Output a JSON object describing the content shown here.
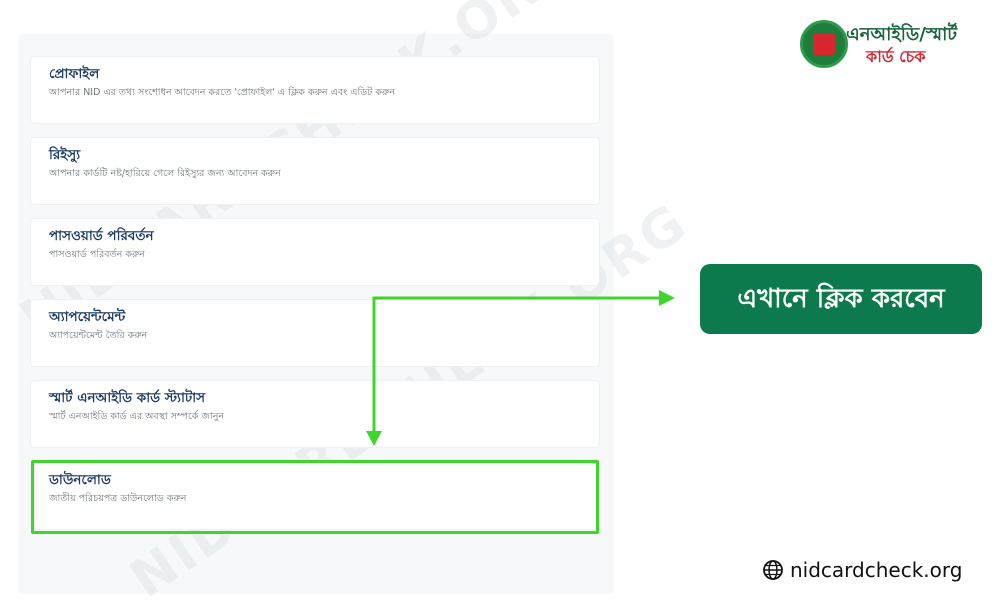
{
  "logo": {
    "line1": "এনআইডি/স্মার্ট",
    "line2": "কার্ড চেক",
    "icon": "nid-emblem-icon"
  },
  "menu": {
    "items": [
      {
        "title": "প্রোফাইল",
        "subtitle": "আপনার NID এর তথ্য সংশোধন আবেদন করতে 'প্রোফাইল' এ ক্লিক করুন এবং এডিট করুন"
      },
      {
        "title": "রিইস্যু",
        "subtitle": "আপনার কার্ডটি নষ্ট/হারিয়ে গেলে রিইস্যুর জন্য আবেদন করুন"
      },
      {
        "title": "পাসওয়ার্ড পরিবর্তন",
        "subtitle": "পাসওয়ার্ড পরিবর্তন করুন"
      },
      {
        "title": "অ্যাপয়েন্টমেন্ট",
        "subtitle": "অ্যাপয়েন্টমেন্ট তৈরি করুন"
      },
      {
        "title": "স্মার্ট এনআইডি কার্ড স্ট্যাটাস",
        "subtitle": "স্মার্ট এনআইডি কার্ড এর অবস্থা সম্পর্কে জানুন"
      },
      {
        "title": "ডাউনলোড",
        "subtitle": "জাতীয় পরিচয়পত্র ডাউনলোড করুন"
      }
    ]
  },
  "callout": {
    "text": "এখানে ক্লিক করবেন"
  },
  "watermark": {
    "text": "NIDCARDCHECK.ORG"
  },
  "footer": {
    "site": "nidcardcheck.org",
    "icon": "globe-icon"
  },
  "colors": {
    "highlight": "#3fd62b",
    "callout_bg": "#0d7a4e",
    "title": "#1d3b63",
    "logo_green": "#17643a",
    "logo_red": "#d3292f"
  }
}
